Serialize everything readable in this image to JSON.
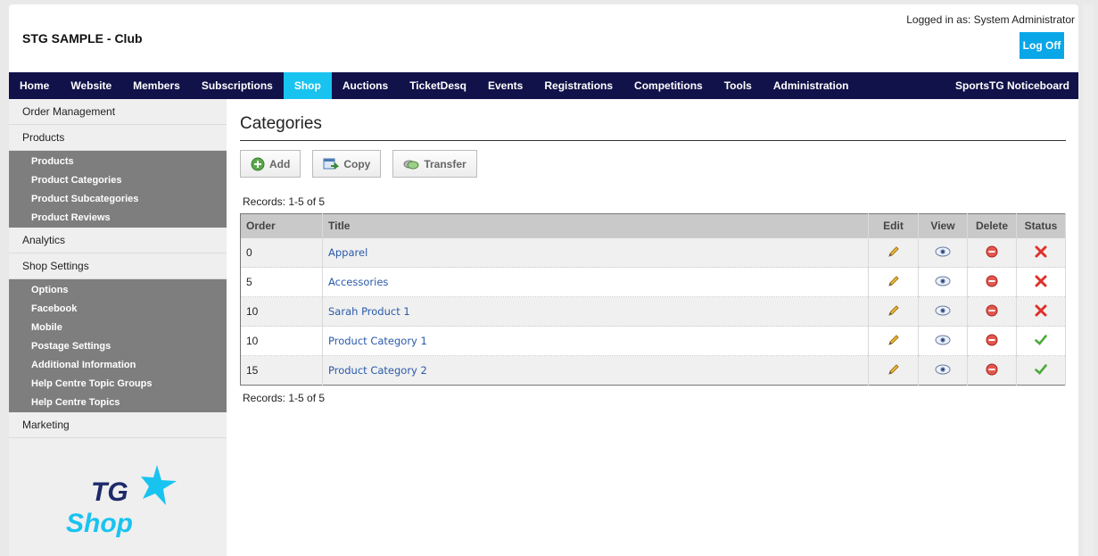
{
  "header": {
    "club_title": "STG SAMPLE - Club",
    "logged_in": "Logged in as: System Administrator",
    "logoff_label": "Log Off"
  },
  "nav": {
    "items": [
      "Home",
      "Website",
      "Members",
      "Subscriptions",
      "Shop",
      "Auctions",
      "TicketDesq",
      "Events",
      "Registrations",
      "Competitions",
      "Tools",
      "Administration"
    ],
    "active": "Shop",
    "right": "SportsTG Noticeboard"
  },
  "sidebar": {
    "order_management": "Order Management",
    "products": "Products",
    "products_sub": [
      "Products",
      "Product Categories",
      "Product Subcategories",
      "Product Reviews"
    ],
    "analytics": "Analytics",
    "shop_settings": "Shop Settings",
    "settings_sub": [
      "Options",
      "Facebook",
      "Mobile",
      "Postage Settings",
      "Additional Information",
      "Help Centre Topic Groups",
      "Help Centre Topics"
    ],
    "marketing": "Marketing"
  },
  "logo": {
    "line1": "TG",
    "line2": "Shop"
  },
  "main": {
    "title": "Categories",
    "buttons": {
      "add": "Add",
      "copy": "Copy",
      "transfer": "Transfer"
    },
    "records_top": "Records: 1-5 of 5",
    "records_bottom": "Records: 1-5 of 5",
    "columns": {
      "order": "Order",
      "title": "Title",
      "edit": "Edit",
      "view": "View",
      "delete": "Delete",
      "status": "Status"
    },
    "rows": [
      {
        "order": "0",
        "title": "Apparel",
        "status": "inactive"
      },
      {
        "order": "5",
        "title": "Accessories",
        "status": "inactive"
      },
      {
        "order": "10",
        "title": "Sarah Product 1",
        "status": "inactive"
      },
      {
        "order": "10",
        "title": "Product Category 1",
        "status": "active"
      },
      {
        "order": "15",
        "title": "Product Category 2",
        "status": "active"
      }
    ]
  },
  "colors": {
    "nav_bg": "#12124a",
    "nav_active": "#19c3f0",
    "logoff": "#0aa7e8",
    "link": "#2a5aa8",
    "logo_blue": "#1d2a6b",
    "logo_cyan": "#19c3f0"
  }
}
